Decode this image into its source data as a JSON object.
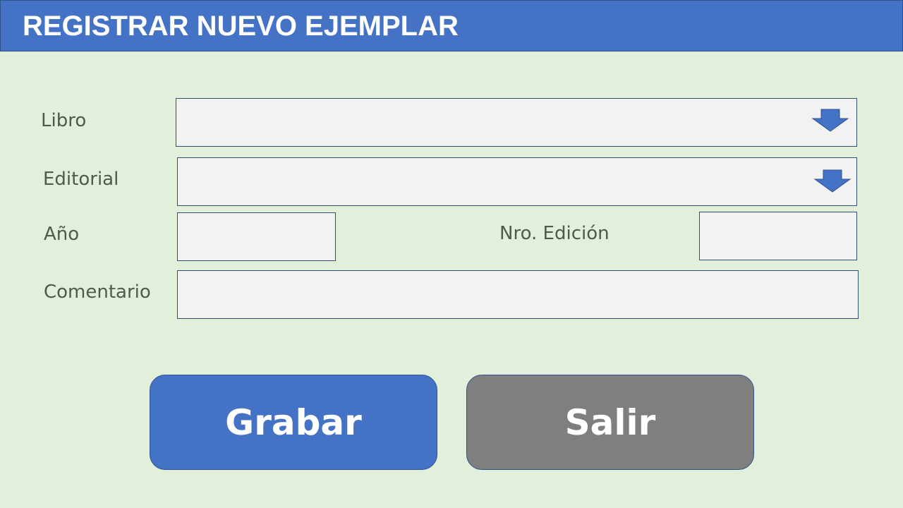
{
  "header": {
    "title": "REGISTRAR NUEVO EJEMPLAR"
  },
  "form": {
    "libro": {
      "label": "Libro",
      "value": "",
      "icon": "arrow-down-icon"
    },
    "editorial": {
      "label": "Editorial",
      "value": "",
      "icon": "arrow-down-icon"
    },
    "anio": {
      "label": "Año",
      "value": ""
    },
    "nro_edicion": {
      "label": "Nro. Edición",
      "value": ""
    },
    "comentario": {
      "label": "Comentario",
      "value": ""
    }
  },
  "buttons": {
    "grabar": "Grabar",
    "salir": "Salir"
  },
  "colors": {
    "header": "#4472c4",
    "background": "#e2efda",
    "primary_button": "#4472c4",
    "secondary_button": "#7f7f7f",
    "field": "#f2f2f2"
  }
}
